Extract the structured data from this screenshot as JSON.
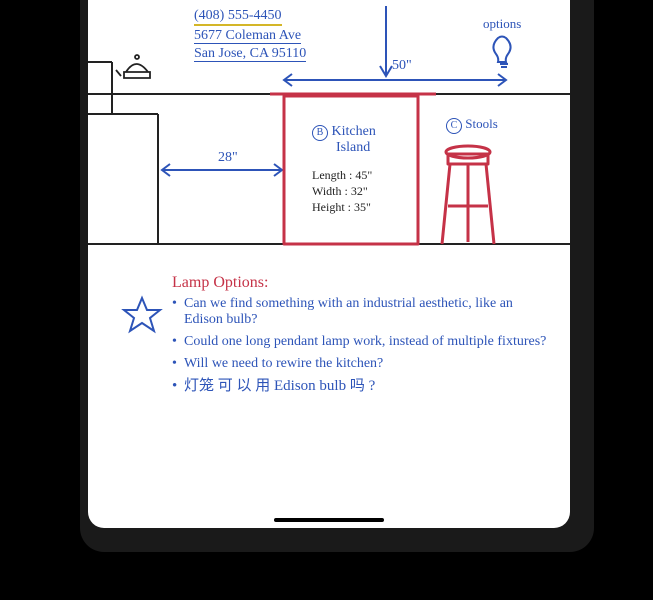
{
  "contact": {
    "phone": "(408) 555-4450",
    "street": "5677 Coleman Ave",
    "city": "San Jose, CA 95110"
  },
  "sketch": {
    "lamp_hint": "options",
    "dim_top": "50\"",
    "dim_left": "28\"",
    "island_tag": "B",
    "island_title_1": "Kitchen",
    "island_title_2": "Island",
    "island_spec_1": "Length : 45\"",
    "island_spec_2": "Width : 32\"",
    "island_spec_3": "Height : 35\"",
    "stool_tag": "C",
    "stool_label": "Stools"
  },
  "notes": {
    "heading": "Lamp Options:",
    "bullets": [
      "Can we find something with an industrial aesthetic, like an Edison bulb?",
      "Could one long pendant lamp work, instead of multiple fixtures?",
      "Will we need to rewire the kitchen?",
      "灯笼 可 以 用 Edison bulb 吗 ?"
    ]
  },
  "colors": {
    "ink_blue": "#2d54b8",
    "ink_red": "#c53247",
    "ink_black": "#222222",
    "hilite": "#d4b628"
  }
}
